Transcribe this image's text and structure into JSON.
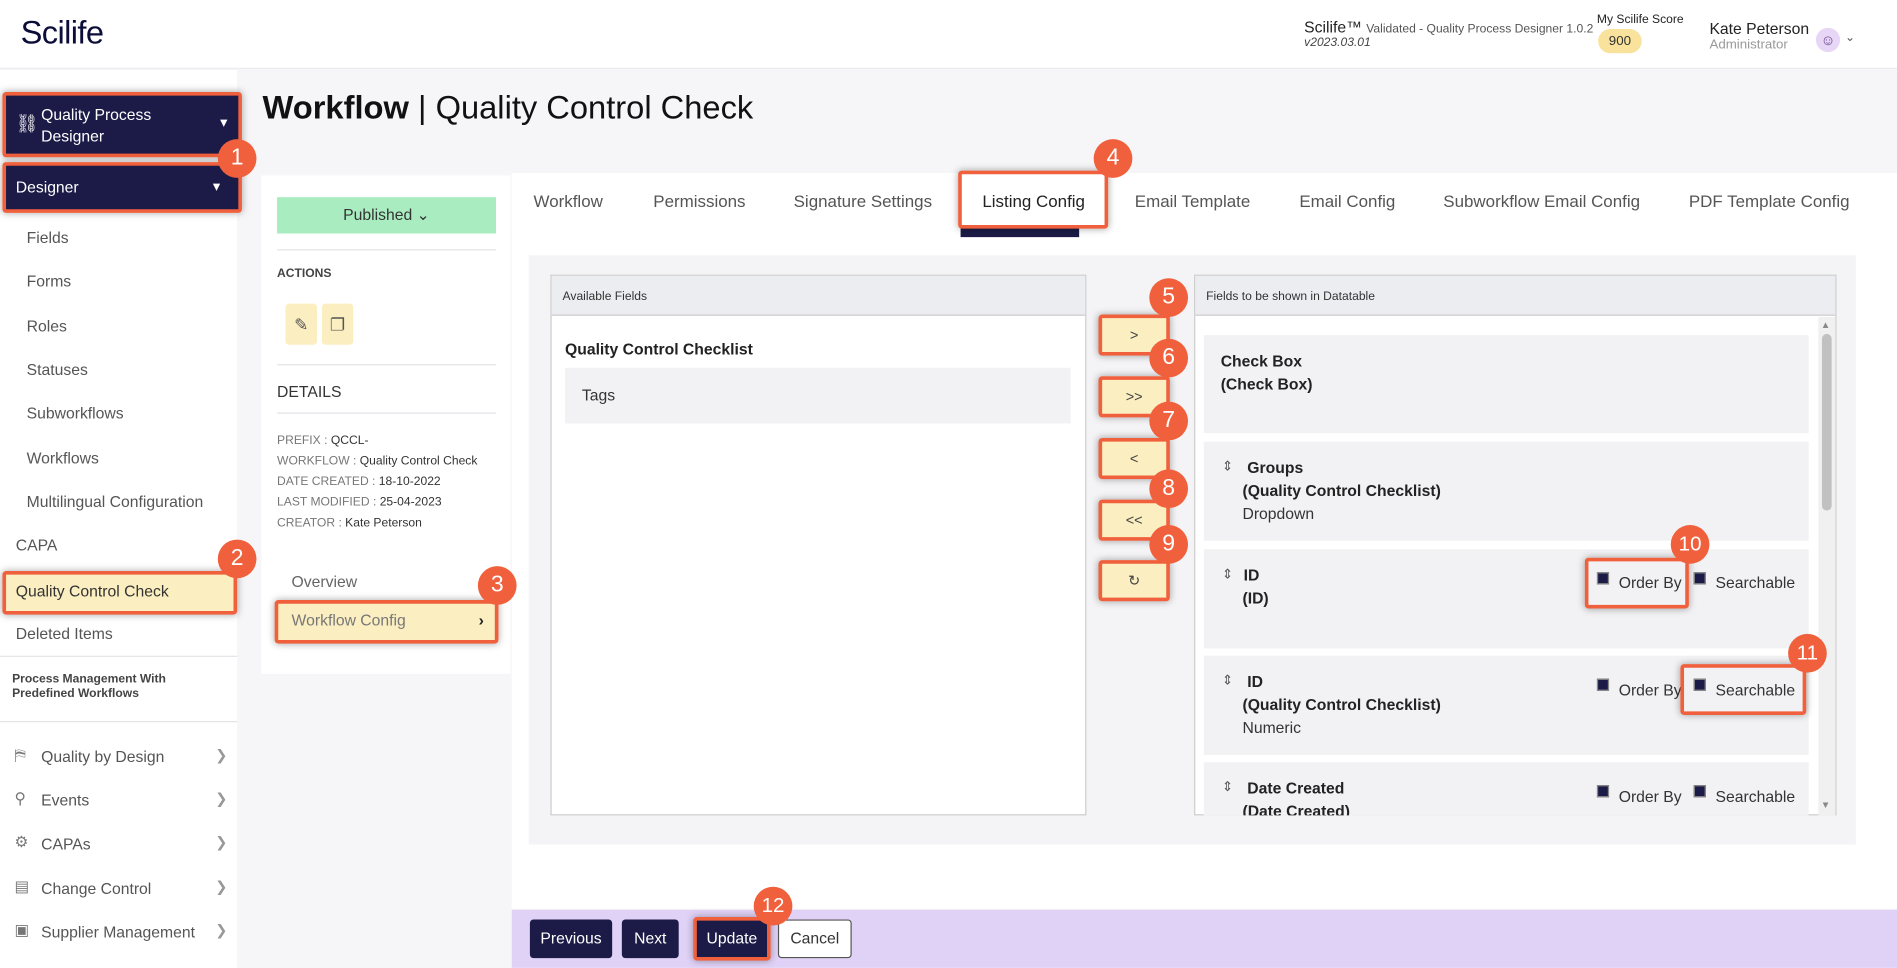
{
  "header": {
    "logo": "Scilife",
    "app_name": "Scilife™",
    "app_subtitle": "Validated - Quality Process Designer 1.0.2",
    "app_version": "v2023.03.01",
    "score_label": "My Scilife Score",
    "score_value": "900",
    "user_name": "Kate Peterson",
    "user_role": "Administrator"
  },
  "sidebar": {
    "module_selector": "Quality Process Designer",
    "section_selector": "Designer",
    "designer_items": [
      "Fields",
      "Forms",
      "Roles",
      "Statuses",
      "Subworkflows",
      "Workflows",
      "Multilingual Configuration"
    ],
    "capa": "CAPA",
    "quality_control_check": "Quality Control Check",
    "deleted_items": "Deleted Items",
    "pm_title": "Process Management With Predefined Workflows",
    "modules": [
      "Quality by Design",
      "Events",
      "CAPAs",
      "Change Control",
      "Supplier Management"
    ]
  },
  "page": {
    "title_bold": "Workflow",
    "title_sep": " | ",
    "title_rest": "Quality Control Check"
  },
  "left_panel": {
    "status": "Published",
    "actions_label": "ACTIONS",
    "details_label": "DETAILS",
    "details": [
      {
        "key": "PREFIX :",
        "value": "QCCL-"
      },
      {
        "key": "WORKFLOW :",
        "value": "Quality Control Check"
      },
      {
        "key": "DATE CREATED :",
        "value": "18-10-2022"
      },
      {
        "key": "LAST MODIFIED :",
        "value": "25-04-2023"
      },
      {
        "key": "CREATOR :",
        "value": "Kate Peterson"
      }
    ],
    "overview": "Overview",
    "workflow_config": "Workflow Config"
  },
  "tabs": [
    "Workflow",
    "Permissions",
    "Signature Settings",
    "Listing Config",
    "Email Template",
    "Email Config",
    "Subworkflow Email Config",
    "PDF Template Config"
  ],
  "listing": {
    "available_header": "Available Fields",
    "available_group": "Quality Control Checklist",
    "available_items": [
      "Tags"
    ],
    "shown_header": "Fields to be shown in Datatable",
    "move_buttons": [
      ">",
      ">>",
      "<",
      "<<",
      "↻"
    ],
    "order_by_label": "Order By",
    "searchable_label": "Searchable",
    "fields": [
      {
        "name": "Check Box",
        "source": "(Check Box)",
        "type": ""
      },
      {
        "name": "Groups",
        "source": "(Quality Control Checklist)",
        "type": "Dropdown"
      },
      {
        "name": "ID",
        "source": "(ID)",
        "type": ""
      },
      {
        "name": "ID",
        "source": "(Quality Control Checklist)",
        "type": "Numeric"
      },
      {
        "name": "Date Created",
        "source": "(Date Created)",
        "type": ""
      }
    ]
  },
  "footer": {
    "previous": "Previous",
    "next": "Next",
    "update": "Update",
    "cancel": "Cancel"
  },
  "annotations": [
    "1",
    "2",
    "3",
    "4",
    "5",
    "6",
    "7",
    "8",
    "9",
    "10",
    "11",
    "12"
  ],
  "colors": {
    "navy": "#1c1b47",
    "highlight": "#f0603c",
    "yellow": "#fbeec0",
    "published": "#a8ecc0",
    "footer": "#e0d2f7"
  }
}
